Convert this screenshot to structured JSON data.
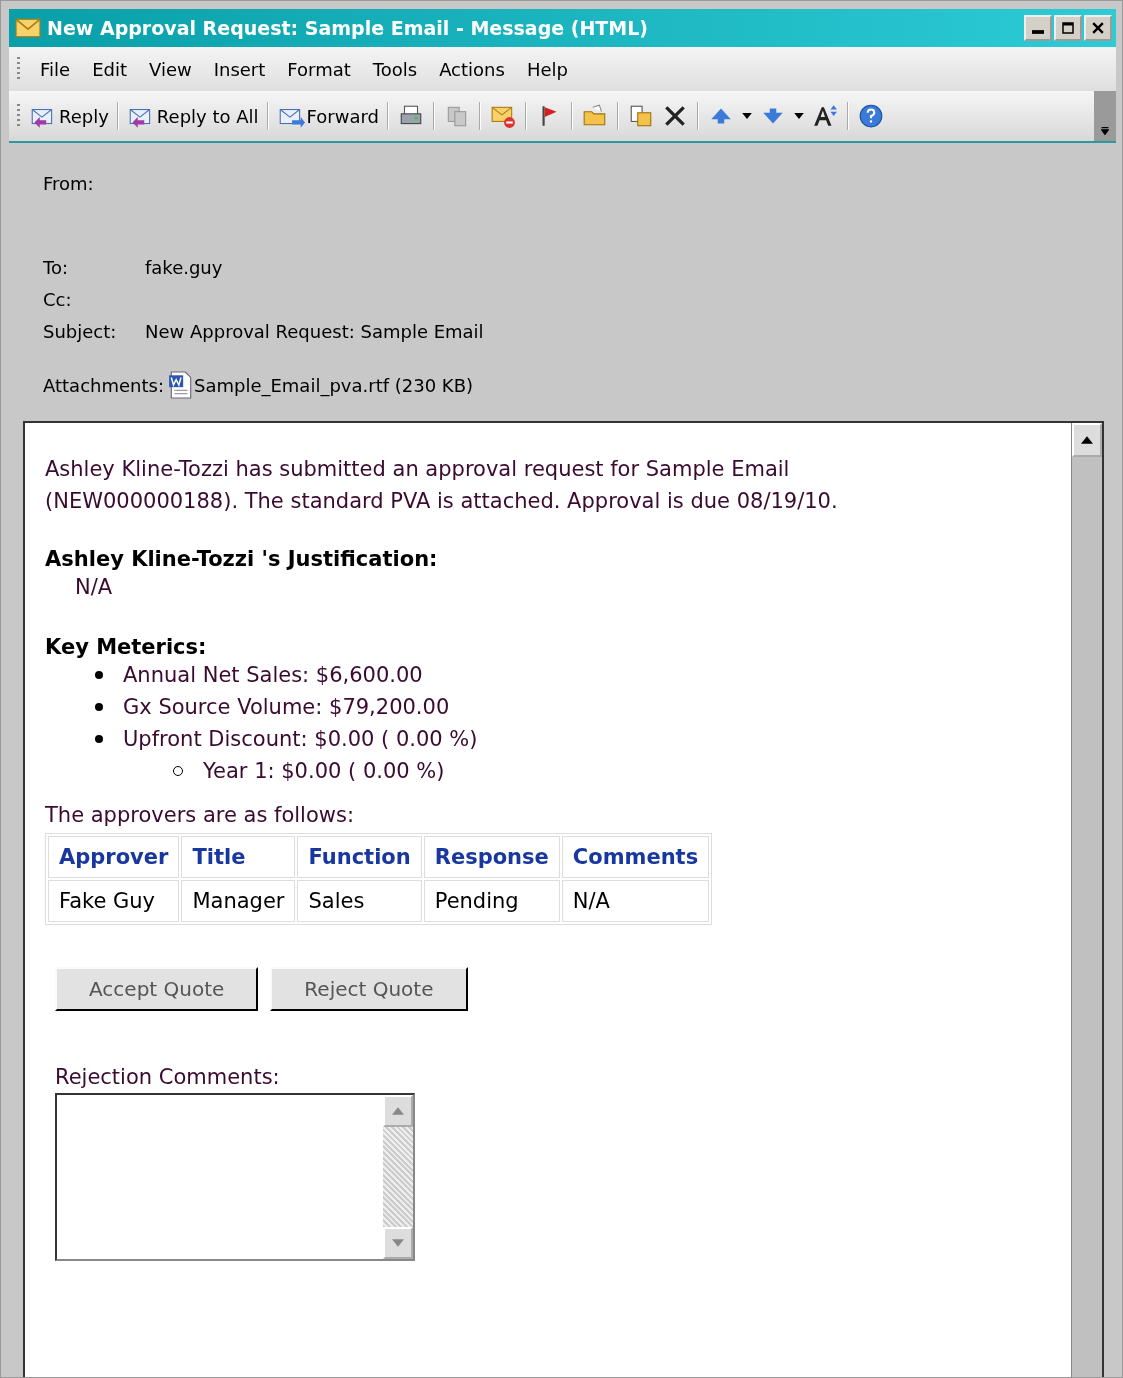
{
  "window": {
    "title": "New Approval Request: Sample Email - Message (HTML)"
  },
  "menu": [
    {
      "label": "File"
    },
    {
      "label": "Edit"
    },
    {
      "label": "View"
    },
    {
      "label": "Insert"
    },
    {
      "label": "Format"
    },
    {
      "label": "Tools"
    },
    {
      "label": "Actions"
    },
    {
      "label": "Help"
    }
  ],
  "toolbar": [
    {
      "label": "Reply"
    },
    {
      "label": "Reply to All"
    },
    {
      "label": "Forward"
    }
  ],
  "header": {
    "from_label": "From:",
    "fields": [
      {
        "label": "To:",
        "value": "fake.guy"
      },
      {
        "label": "Cc:"
      },
      {
        "label": "Subject:",
        "value": "New Approval Request: Sample Email"
      }
    ],
    "attachments_label": "Attachments:",
    "attachment": "Sample_Email_pva.rtf (230 KB)"
  },
  "body": {
    "intro": "Ashley Kline-Tozzi has submitted an approval request for Sample Email (NEW000000188). The standard PVA is attached. Approval is due 08/19/10.",
    "justification_heading": "Ashley Kline-Tozzi 's Justification:",
    "justification": "N/A",
    "metrics_heading": "Key Meterics:",
    "metrics": [
      {
        "text": "Annual Net Sales: $6,600.00"
      },
      {
        "text": "Gx Source Volume: $79,200.00"
      },
      {
        "text": "Upfront Discount: $0.00 ( 0.00 %)",
        "children": [
          {
            "text": "Year 1: $0.00 ( 0.00 %)"
          }
        ]
      }
    ],
    "approvers_intro": "The approvers are as follows:",
    "table": {
      "columns": [
        "Approver",
        "Title",
        "Function",
        "Response",
        "Comments"
      ],
      "rows": [
        [
          "Fake Guy",
          "Manager",
          "Sales",
          "Pending",
          "N/A"
        ]
      ]
    },
    "buttons": [
      "Accept Quote",
      "Reject Quote"
    ],
    "rejection_label": "Rejection Comments:"
  }
}
